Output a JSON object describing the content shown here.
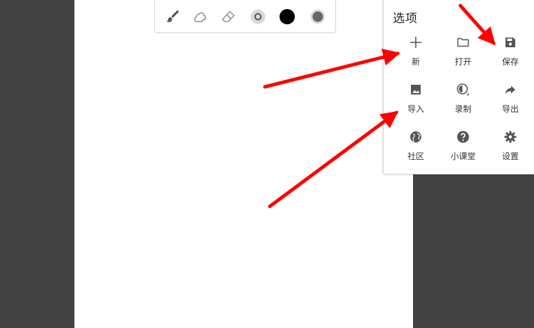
{
  "toolbar": {
    "tools": [
      {
        "name": "brush-icon"
      },
      {
        "name": "smudge-icon"
      },
      {
        "name": "eraser-icon"
      },
      {
        "name": "brush-size-icon"
      },
      {
        "name": "color-swatch-icon",
        "color": "#000000"
      },
      {
        "name": "opacity-icon",
        "color": "#666666"
      }
    ]
  },
  "options_panel": {
    "title": "选项",
    "items": [
      {
        "label": "新",
        "icon": "plus-icon"
      },
      {
        "label": "打开",
        "icon": "folder-icon"
      },
      {
        "label": "保存",
        "icon": "save-icon"
      },
      {
        "label": "导入",
        "icon": "image-icon"
      },
      {
        "label": "录制",
        "icon": "record-icon"
      },
      {
        "label": "导出",
        "icon": "share-arrow-icon"
      },
      {
        "label": "社区",
        "icon": "globe-icon"
      },
      {
        "label": "小课堂",
        "icon": "help-icon"
      },
      {
        "label": "设置",
        "icon": "gear-icon"
      }
    ]
  },
  "colors": {
    "background": "#424242",
    "canvas": "#ffffff",
    "annotation_arrow": "#ff0000",
    "icon": "#555555"
  }
}
